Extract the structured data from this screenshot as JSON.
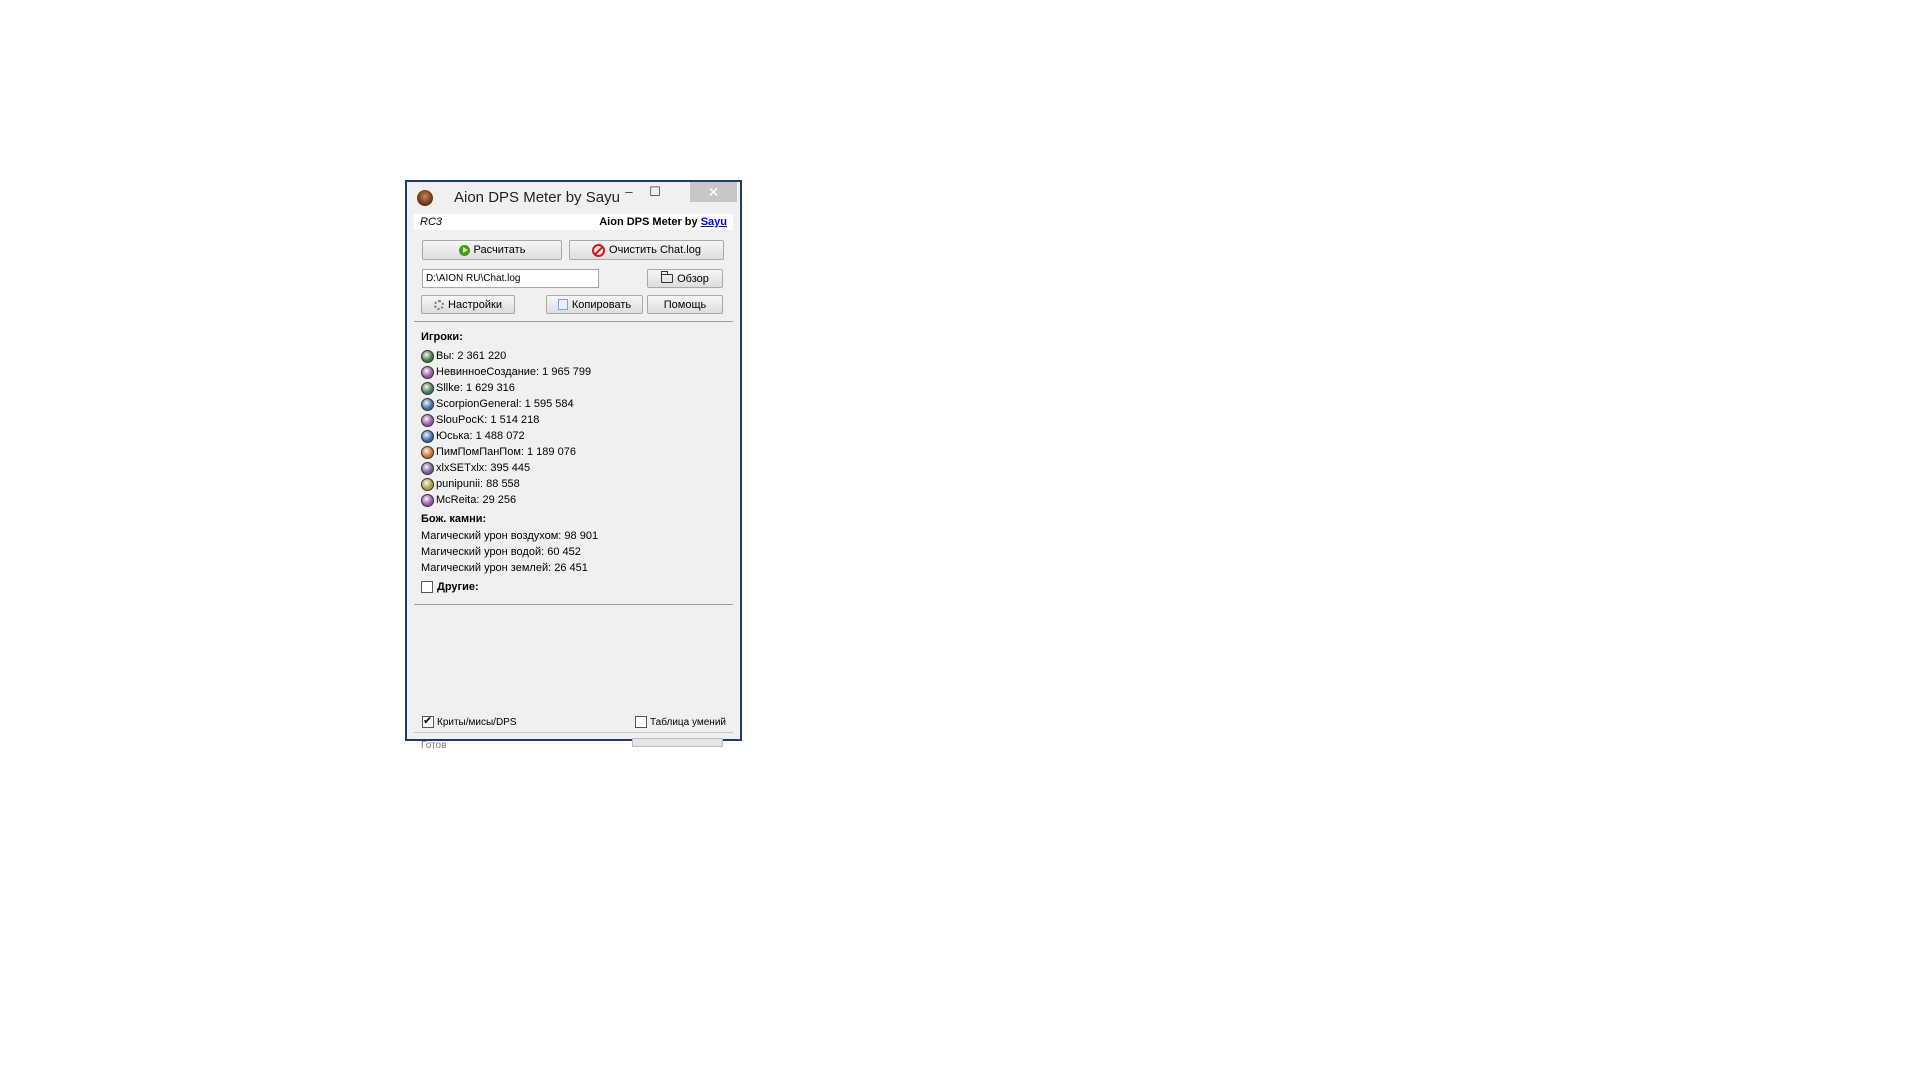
{
  "window": {
    "title": "Aion DPS Meter by Sayu",
    "minimize": "–",
    "maximize": "☐",
    "close": "✕"
  },
  "header": {
    "version": "RC3",
    "brand_prefix": "Aion DPS Meter by ",
    "brand_link": "Sayu"
  },
  "toolbar": {
    "calculate_label": "Расчитать",
    "clear_label": "Очистить Chat.log",
    "path_value": "D:\\AION RU\\Chat.log",
    "browse_label": "Обзор",
    "settings_label": "Настройки",
    "copy_label": "Копировать",
    "help_label": "Помощь"
  },
  "players": {
    "title": "Игроки:",
    "items": [
      {
        "text": "Вы: 2 361 220",
        "icon": "class-icon",
        "color": "#3c7a3a"
      },
      {
        "text": "НевинноеСоздание: 1 965 799",
        "icon": "class-icon",
        "color": "#9b4fa0"
      },
      {
        "text": "Sllke: 1 629 316",
        "icon": "class-icon",
        "color": "#3f7a52"
      },
      {
        "text": "ScorpionGeneral: 1 595 584",
        "icon": "class-icon",
        "color": "#3a67a8"
      },
      {
        "text": "SlouPocK: 1 514 218",
        "icon": "class-icon",
        "color": "#a04fa6"
      },
      {
        "text": "Юська: 1 488 072",
        "icon": "class-icon",
        "color": "#3a67a8"
      },
      {
        "text": "ПимПомПанПом: 1 189 076",
        "icon": "class-icon",
        "color": "#d26a1e"
      },
      {
        "text": "xlxSETxlx: 395 445",
        "icon": "class-icon",
        "color": "#6f5a9c"
      },
      {
        "text": "punipunii: 88 558",
        "icon": "class-icon",
        "color": "#a89a3a"
      },
      {
        "text": "McReita: 29 256",
        "icon": "class-icon",
        "color": "#9a4fb0"
      }
    ]
  },
  "godstones": {
    "title": "Бож. камни:",
    "items": [
      "Магический урон воздухом: 98 901",
      "Магический урон водой: 60 452",
      "Магический урон землей: 26 451"
    ]
  },
  "others": {
    "label": "Другие:",
    "checked": false
  },
  "options": {
    "crits_label": "Криты/мисы/DPS",
    "crits_checked": true,
    "skills_label": "Таблица умений",
    "skills_checked": false
  },
  "status": {
    "text": "Готов",
    "progress": 0
  }
}
